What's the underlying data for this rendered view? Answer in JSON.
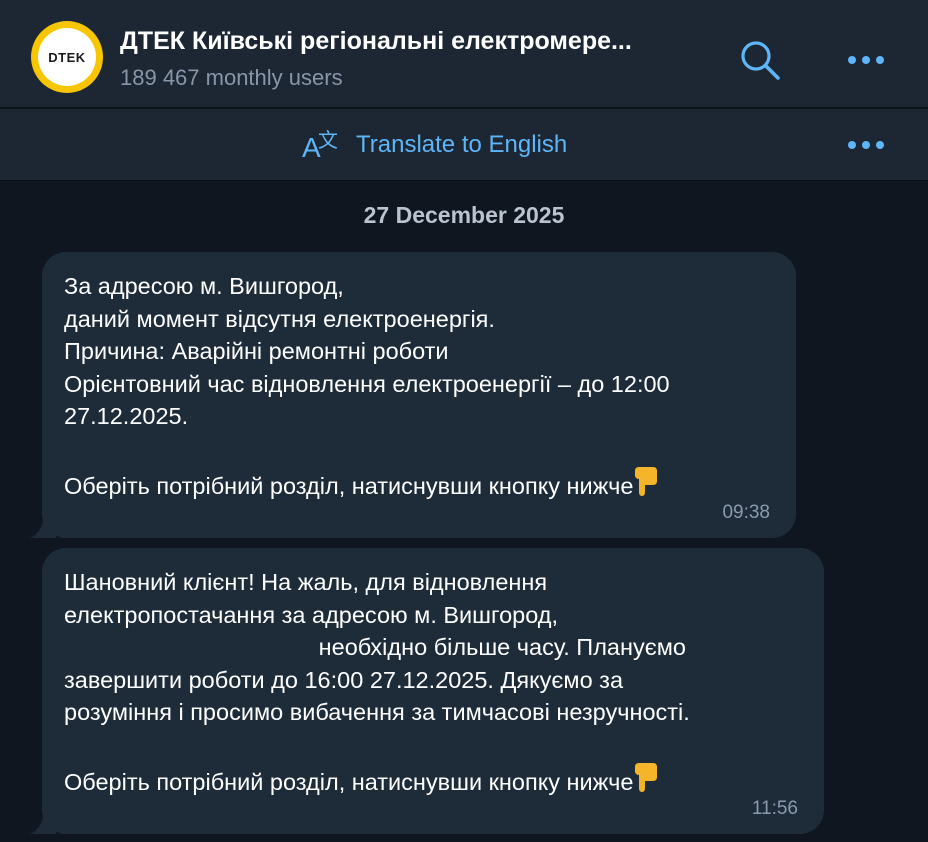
{
  "header": {
    "avatar_text": "DTEK",
    "title": "ДТЕК Київські регіональні електромере...",
    "subtitle": "189 467 monthly users",
    "icons": {
      "search": "search-icon",
      "more": "more-dots-icon"
    }
  },
  "translate_bar": {
    "label": "Translate to English",
    "icon": "translate-icon"
  },
  "date_separator": "27 December 2025",
  "messages": [
    {
      "text": "За адресою м. Вишгород,\nданий момент відсутня електроенергія.\nПричина: Аварійні ремонтні роботи\nОрієнтовний час відновлення електроенергії – до 12:00\n27.12.2025.\n\nОберіть потрібний розділ, натиснувши кнопку нижче",
      "time": "09:38"
    },
    {
      "text": "Шановний клієнт! На жаль, для відновлення\nелектропостачання за адресою м. Вишгород,\n                                       необхідно більше часу. Плануємо\nзавершити роботи до 16:00 27.12.2025. Дякуємо за\nрозуміння і просимо вибачення за тимчасові незручності.\n\nОберіть потрібний розділ, натиснувши кнопку нижче",
      "time": "11:56"
    }
  ],
  "colors": {
    "background": "#0f1620",
    "header": "#1c2733",
    "bubble": "#1e2c3a",
    "accent": "#5eb5f7",
    "muted": "#8796a8",
    "avatar_ring": "#f7c600"
  }
}
